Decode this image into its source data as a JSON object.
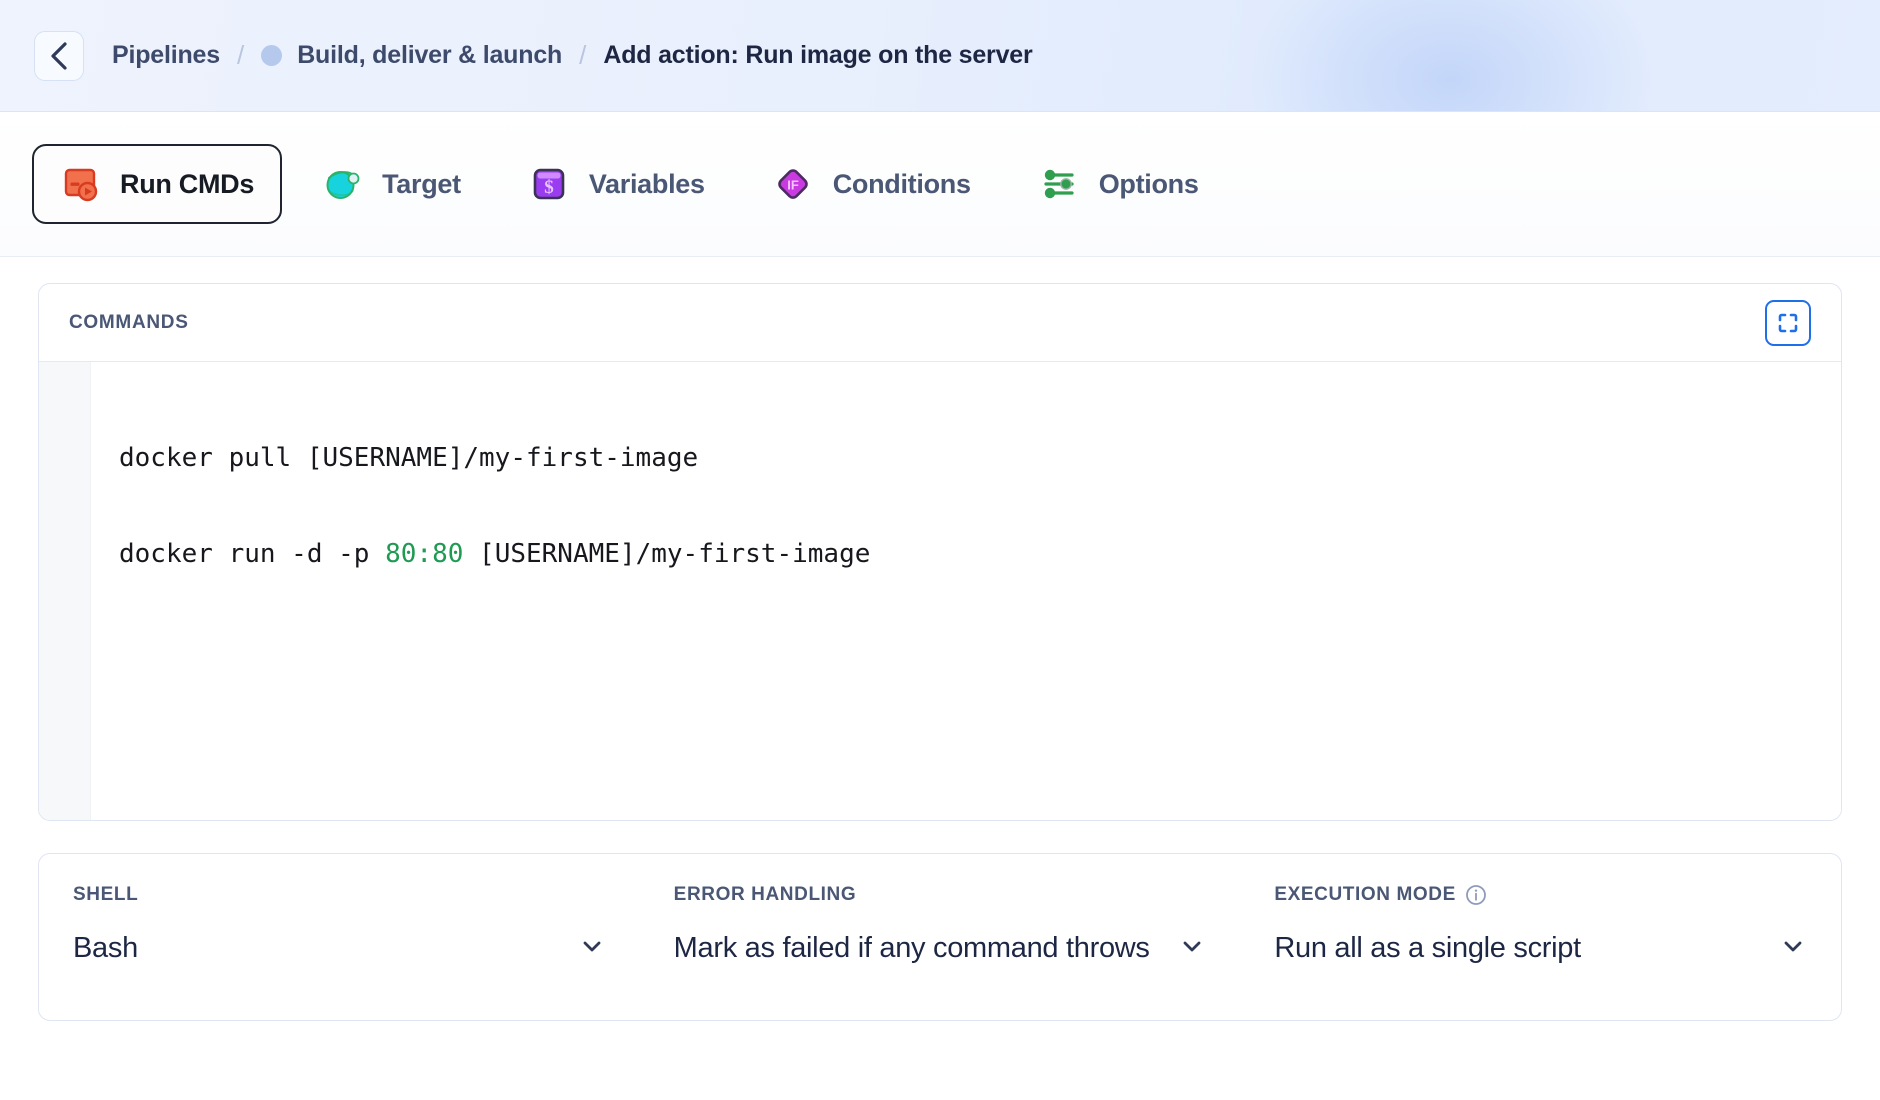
{
  "header": {
    "back_icon": "chevron-left-icon",
    "breadcrumb": {
      "root_label": "Pipelines",
      "separator": "/",
      "pipeline_dot": "pipeline-status-dot",
      "pipeline_label": "Build, deliver & launch",
      "current_label": "Add action: Run image on the server"
    }
  },
  "tabs": [
    {
      "label": "Run CMDs",
      "icon": "terminal-run-icon",
      "active": true
    },
    {
      "label": "Target",
      "icon": "planet-icon",
      "active": false
    },
    {
      "label": "Variables",
      "icon": "dollar-card-icon",
      "active": false
    },
    {
      "label": "Conditions",
      "icon": "if-diamond-icon",
      "active": false
    },
    {
      "label": "Options",
      "icon": "sliders-icon",
      "active": false
    }
  ],
  "commands_panel": {
    "title": "COMMANDS",
    "expand_icon": "fullscreen-icon",
    "lines": [
      {
        "pre": "docker pull [USERNAME]/my-first-image",
        "num": "",
        "post": ""
      },
      {
        "pre": "docker run -d -p ",
        "num": "80:80",
        "post": " [USERNAME]/my-first-image"
      }
    ]
  },
  "settings": {
    "shell": {
      "label": "SHELL",
      "value": "Bash",
      "chevron_icon": "chevron-down-icon"
    },
    "error_handling": {
      "label": "ERROR HANDLING",
      "value": "Mark as failed if any command throws",
      "chevron_icon": "chevron-down-icon"
    },
    "execution_mode": {
      "label": "EXECUTION MODE",
      "info_icon": "info-circle-icon",
      "value": "Run all as a single script",
      "chevron_icon": "chevron-down-icon"
    }
  },
  "colors": {
    "accent_blue": "#1f6fea",
    "header_bg": "#e6eefc",
    "text_dark": "#1d2744",
    "text_muted": "#4a5775",
    "code_number_green": "#1f9a52",
    "run_icon_orange": "#ef5b3d",
    "target_icon_cyan": "#17d3dd",
    "variables_icon_purple": "#9a3cf0",
    "conditions_icon_magenta": "#c93ae0",
    "options_icon_green": "#2f9e4f"
  }
}
